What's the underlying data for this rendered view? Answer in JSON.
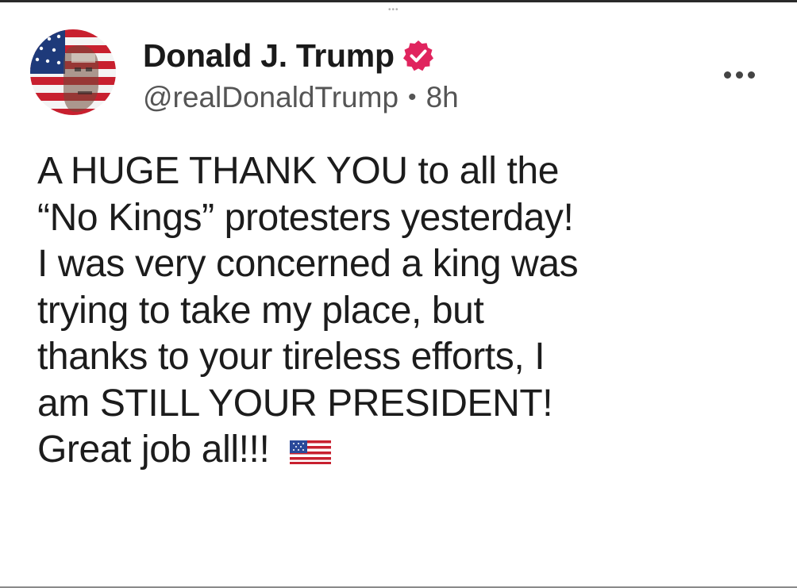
{
  "post": {
    "author": {
      "display_name": "Donald J. Trump",
      "handle": "@realDonaldTrump",
      "separator": "•",
      "time": "8h",
      "verified_color": "#e0245e"
    },
    "drag_indicator": "•••",
    "more_icon": "ellipsis-horizontal-icon",
    "body_lines": [
      "A HUGE THANK YOU to all the",
      "“No Kings” protesters yesterday!",
      "I was very concerned a king was",
      "trying to take my place, but",
      "thanks to your tireless efforts, I",
      "am STILL YOUR PRESIDENT!",
      "Great job all!!!"
    ],
    "emoji": "us-flag-icon"
  }
}
